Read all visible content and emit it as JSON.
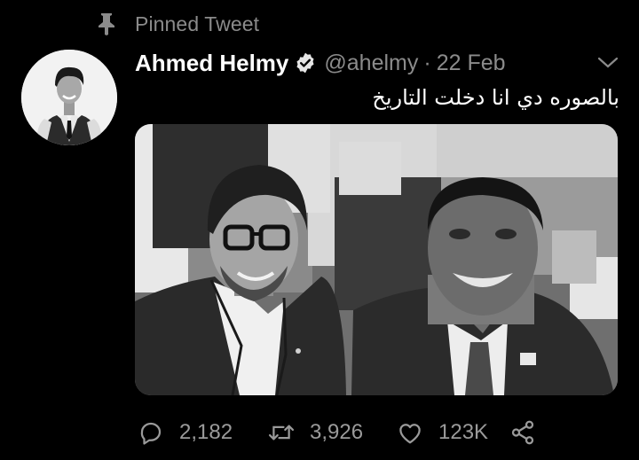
{
  "pinned": {
    "label": "Pinned Tweet",
    "icon": "pin-icon"
  },
  "author": {
    "display_name": "Ahmed Helmy",
    "verified_icon": "verified-badge-icon",
    "handle": "@ahelmy",
    "separator": "·",
    "date": "22 Feb",
    "menu_icon": "chevron-down-icon"
  },
  "tweet": {
    "text": "بالصوره دي انا دخلت التاريخ"
  },
  "actions": {
    "reply_count": "2,182",
    "retweet_count": "3,926",
    "like_count": "123K",
    "reply_icon": "reply-bubble-icon",
    "retweet_icon": "retweet-icon",
    "like_icon": "heart-icon",
    "share_icon": "share-icon"
  },
  "colors": {
    "background": "#000000",
    "primary_text": "#ffffff",
    "secondary_text": "#8b8b8b"
  }
}
